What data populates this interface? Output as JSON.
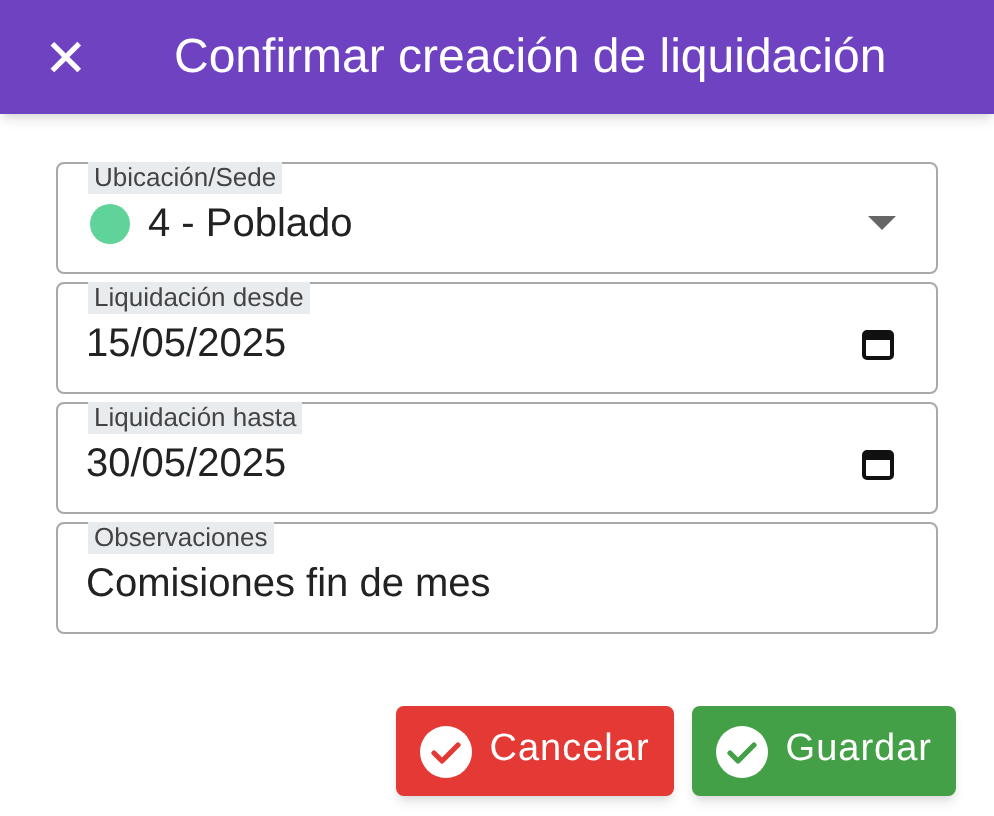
{
  "dialog": {
    "title": "Confirmar creación de liquidación",
    "close_icon": "✕"
  },
  "fields": [
    {
      "kind": "select",
      "label": "Ubicación/Sede",
      "value": "4 - Poblado",
      "color": "#5fd39a"
    },
    {
      "kind": "date",
      "label": "Liquidación desde",
      "value": "15/05/2025"
    },
    {
      "kind": "date",
      "label": "Liquidación hasta",
      "value": "30/05/2025"
    },
    {
      "kind": "text",
      "label": "Observaciones",
      "value": "Comisiones fin de mes"
    }
  ],
  "buttons": [
    {
      "kind": "cancel",
      "label": "Cancelar"
    },
    {
      "kind": "save",
      "label": "Guardar"
    }
  ]
}
